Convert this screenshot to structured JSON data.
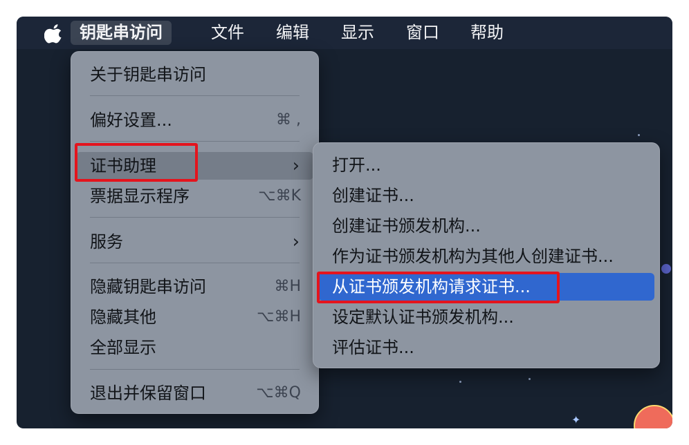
{
  "menubar": {
    "items": [
      "钥匙串访问",
      "文件",
      "编辑",
      "显示",
      "窗口",
      "帮助"
    ]
  },
  "app_menu": {
    "items": [
      {
        "label": "关于钥匙串访问",
        "shortcut": ""
      },
      {
        "label": "偏好设置...",
        "shortcut": "⌘ ,"
      },
      {
        "label": "证书助理",
        "shortcut": ""
      },
      {
        "label": "票据显示程序",
        "shortcut": "⌥⌘K"
      },
      {
        "label": "服务",
        "shortcut": ""
      },
      {
        "label": "隐藏钥匙串访问",
        "shortcut": "⌘H"
      },
      {
        "label": "隐藏其他",
        "shortcut": "⌥⌘H"
      },
      {
        "label": "全部显示",
        "shortcut": ""
      },
      {
        "label": "退出并保留窗口",
        "shortcut": "⌥⌘Q"
      }
    ]
  },
  "submenu": {
    "items": [
      "打开...",
      "创建证书...",
      "创建证书颁发机构...",
      "作为证书颁发机构为其他人创建证书...",
      "从证书颁发机构请求证书...",
      "设定默认证书颁发机构...",
      "评估证书..."
    ]
  },
  "icons": {
    "apple": "apple-logo-icon",
    "submenu_arrow": "chevron-right-icon"
  },
  "colors": {
    "highlight": "#3067cf",
    "annotation": "#e4141d"
  }
}
